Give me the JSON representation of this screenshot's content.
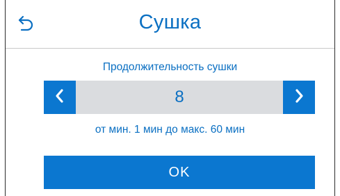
{
  "header": {
    "title": "Сушка",
    "back_icon": "back-arrow-icon"
  },
  "setting": {
    "label": "Продолжительность сушки",
    "value": "8",
    "range_text": "от мин. 1 мин до макс. 60 мин",
    "decrease_icon": "chevron-left-icon",
    "increase_icon": "chevron-right-icon"
  },
  "actions": {
    "ok_label": "OK"
  },
  "colors": {
    "accent": "#0b77d0",
    "text_blue": "#0a6fc2",
    "stepper_bg": "#dadcdf"
  }
}
